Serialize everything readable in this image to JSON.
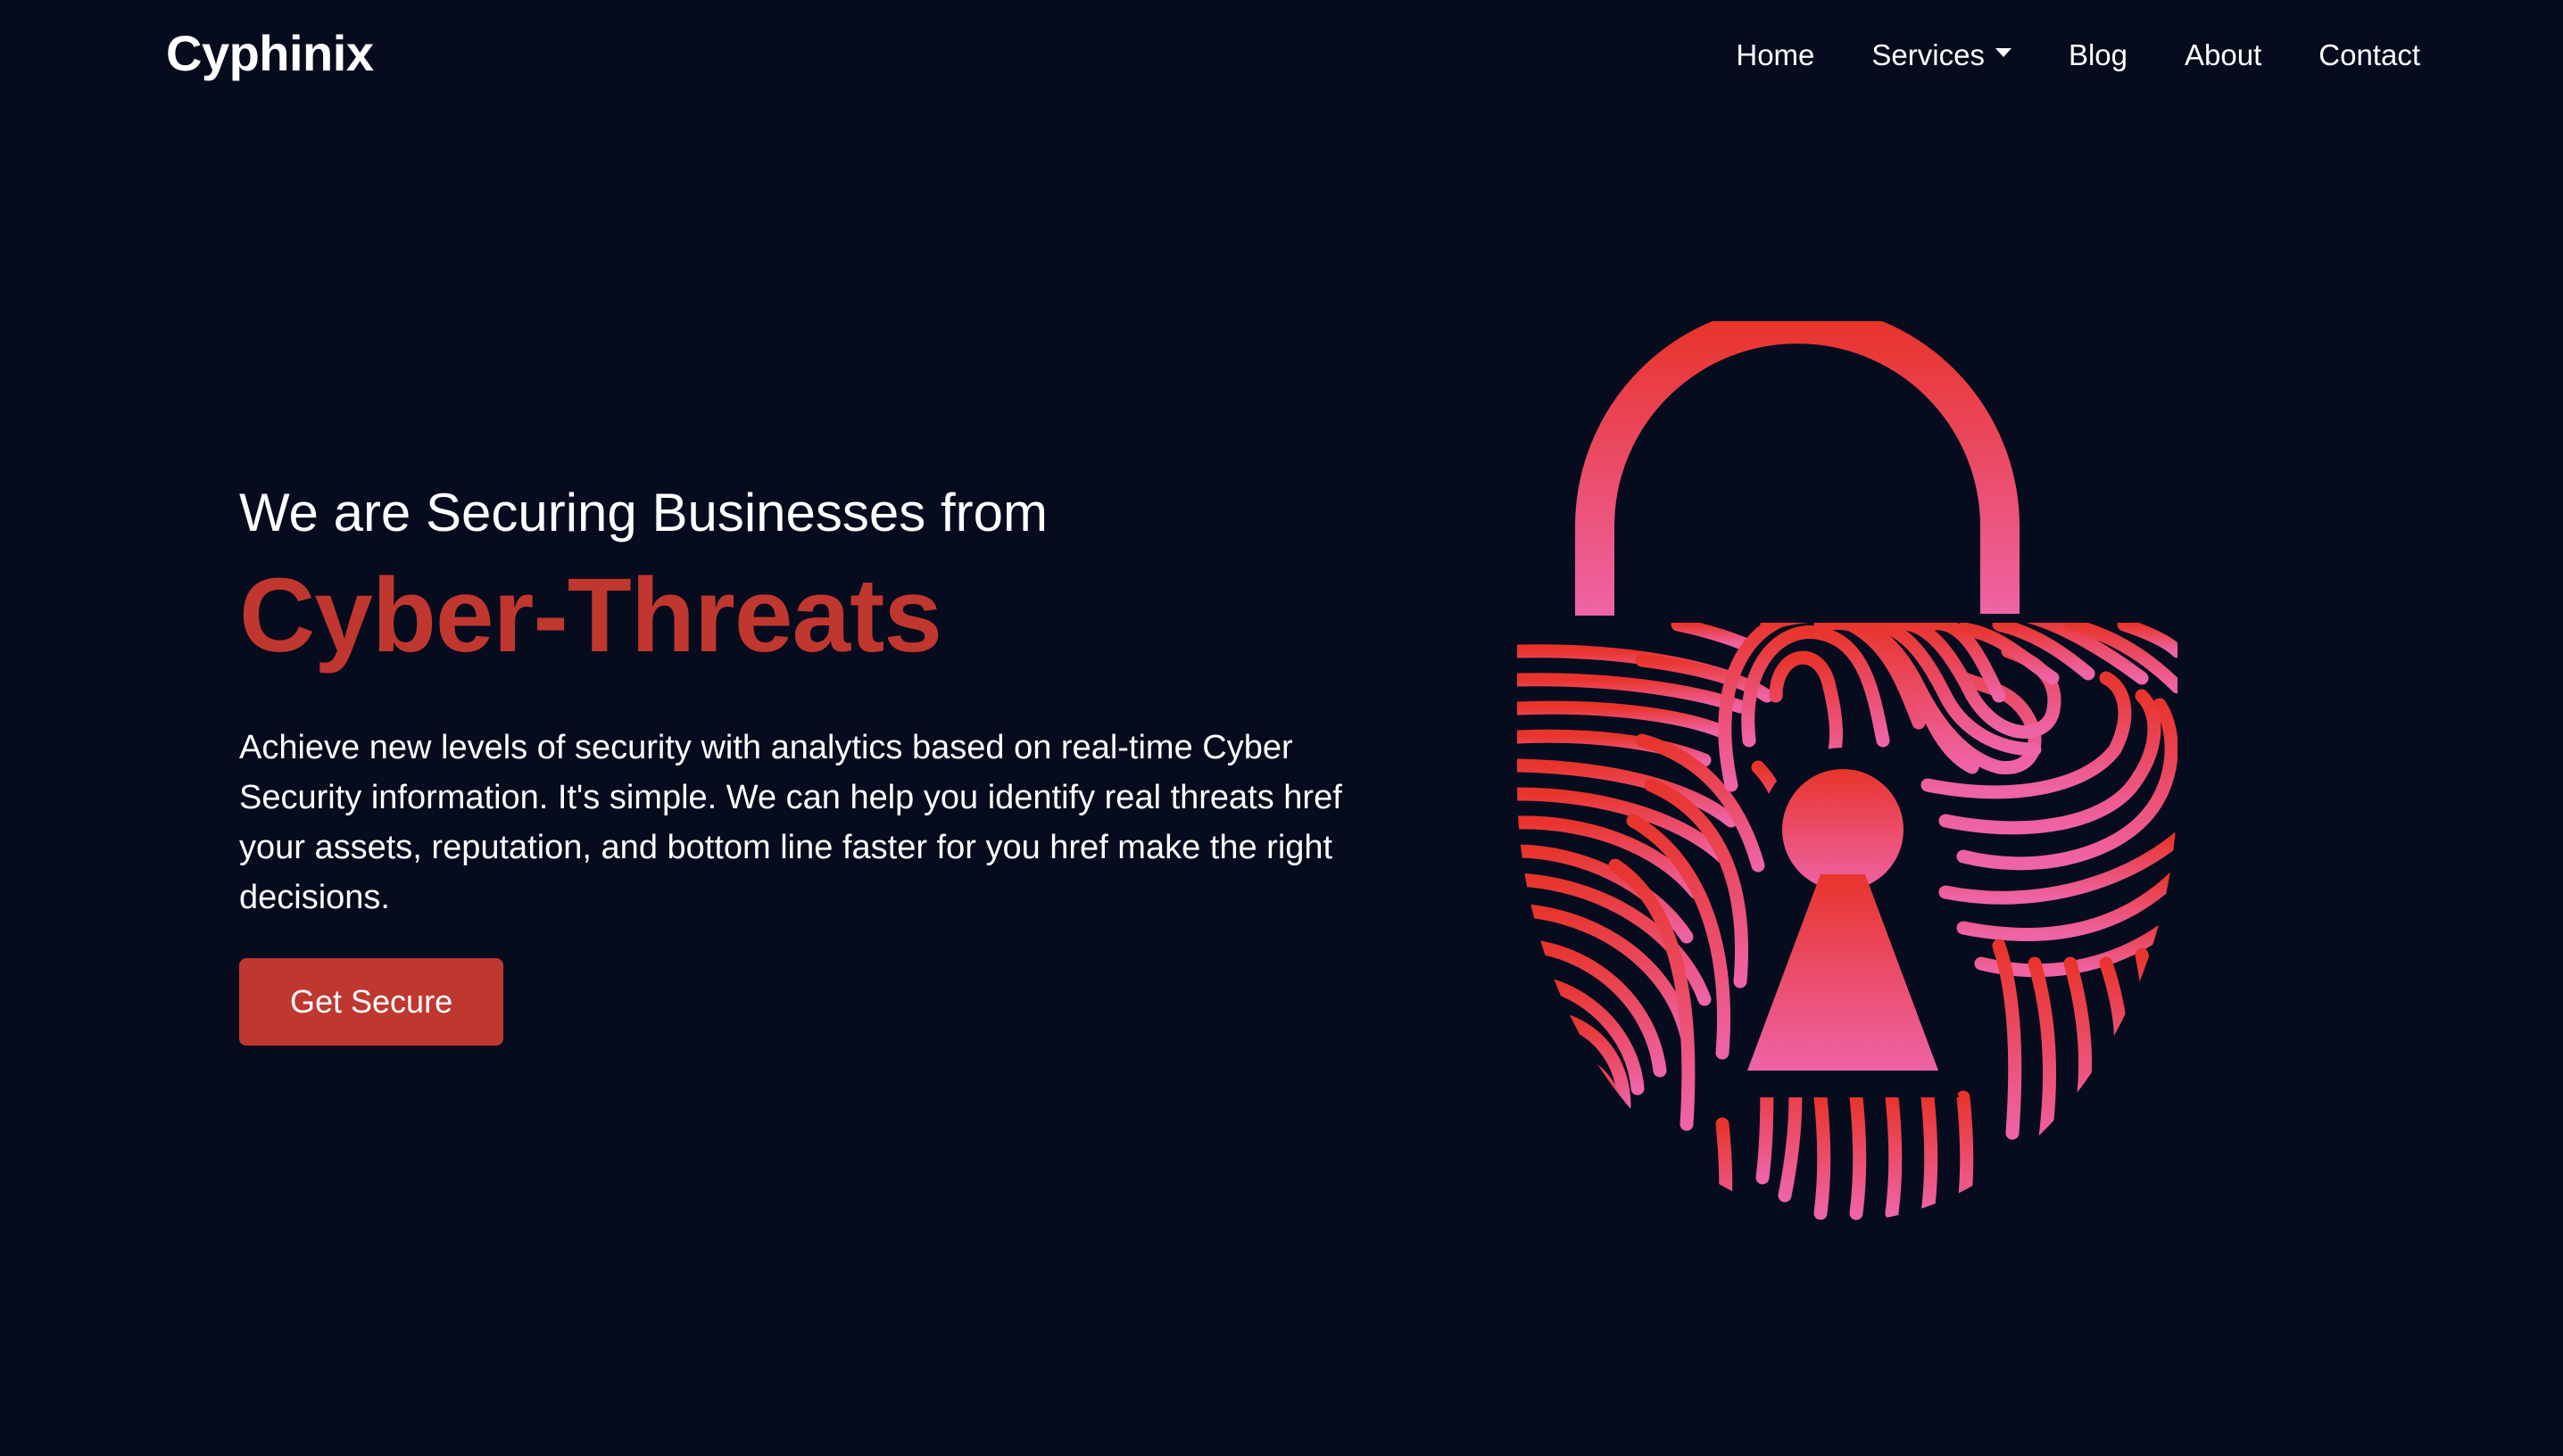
{
  "brand": {
    "name": "Cyphinix"
  },
  "nav": {
    "items": [
      {
        "label": "Home"
      },
      {
        "label": "Services"
      },
      {
        "label": "Blog"
      },
      {
        "label": "About"
      },
      {
        "label": "Contact"
      }
    ]
  },
  "hero": {
    "subtitle": "We are Securing Businesses from",
    "headline": "Cyber-Threats",
    "description": "Achieve new levels of security with analytics based on real-time Cyber Security information. It's simple. We can help you identify real threats href your assets, reputation, and bottom line faster for you href make the right decisions.",
    "cta_label": "Get Secure"
  },
  "illustration": {
    "icon": "fingerprint-padlock-icon",
    "gradient_top": "#e8342c",
    "gradient_bottom": "#ee64a6"
  },
  "colors": {
    "background": "#070b1e",
    "accent": "#c0372f",
    "text": "#ffffff"
  }
}
